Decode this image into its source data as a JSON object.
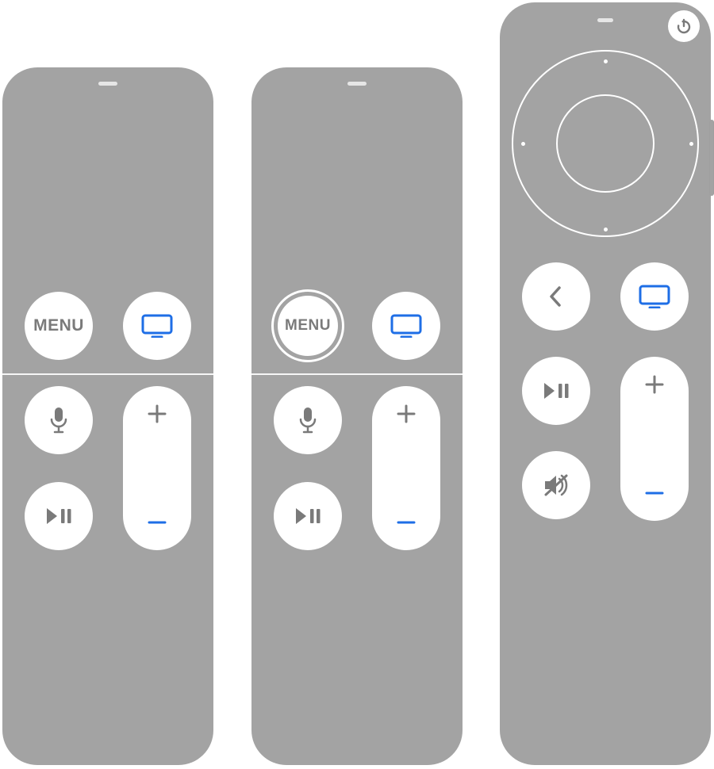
{
  "colors": {
    "remote_body": "#a3a3a3",
    "button_face": "#ffffff",
    "icon_gray": "#7a7a7a",
    "accent_blue": "#1e6ee6"
  },
  "remotes": {
    "gen1": {
      "menu_label": "MENU",
      "buttons": [
        "menu",
        "tv",
        "siri-mic",
        "play-pause",
        "volume-up",
        "volume-down"
      ],
      "highlight": "volume-down"
    },
    "gen1_ring": {
      "menu_label": "MENU",
      "menu_has_white_ring": true,
      "buttons": [
        "menu",
        "tv",
        "siri-mic",
        "play-pause",
        "volume-up",
        "volume-down"
      ],
      "highlight": "volume-down"
    },
    "gen2": {
      "has_power_button": true,
      "has_clickpad_ring": true,
      "buttons": [
        "back",
        "tv",
        "play-pause",
        "mute",
        "volume-up",
        "volume-down"
      ],
      "highlight": "volume-down"
    }
  },
  "icons": {
    "tv": "tv-icon",
    "mic": "microphone-icon",
    "play_pause": "play-pause-icon",
    "plus": "plus-icon",
    "minus": "minus-icon",
    "back": "chevron-left-icon",
    "mute": "speaker-mute-icon",
    "power": "power-icon"
  }
}
